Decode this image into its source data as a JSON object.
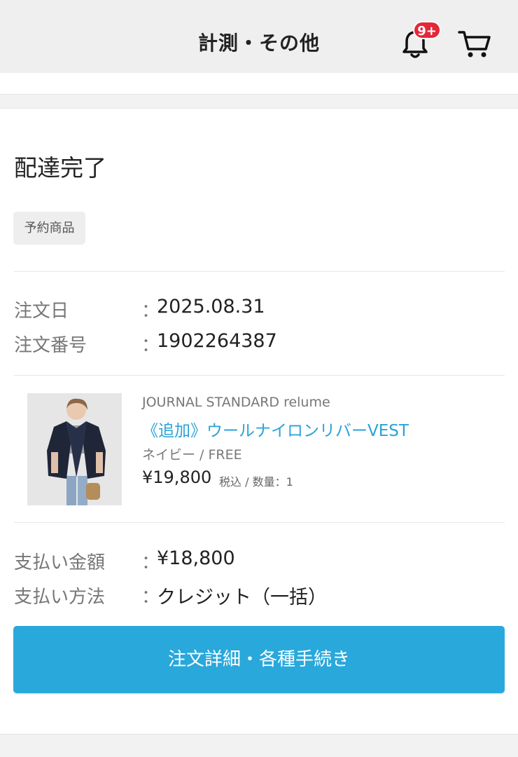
{
  "header": {
    "title": "計測・その他",
    "notification_badge": "9+",
    "icons": {
      "notification": "bell-icon",
      "cart": "cart-icon"
    },
    "badge_color": "#e3283a"
  },
  "order": {
    "status": "配達完了",
    "tag": "予約商品",
    "order_date_label": "注文日",
    "order_date_value": "2025.08.31",
    "order_number_label": "注文番号",
    "order_number_value": "1902264387",
    "colon": "："
  },
  "product": {
    "brand": "JOURNAL STANDARD relume",
    "name": "《追加》ウールナイロンリバーVEST",
    "variant": "ネイビー / FREE",
    "price": "¥19,800",
    "price_note": "税込 / 数量：1",
    "name_color": "#2aa3d6"
  },
  "payment": {
    "amount_label": "支払い金額",
    "amount_value": "¥18,800",
    "method_label": "支払い方法",
    "method_value": "クレジット（一括）"
  },
  "actions": {
    "details_button": "注文詳細・各種手続き",
    "button_color": "#29a8dc"
  }
}
